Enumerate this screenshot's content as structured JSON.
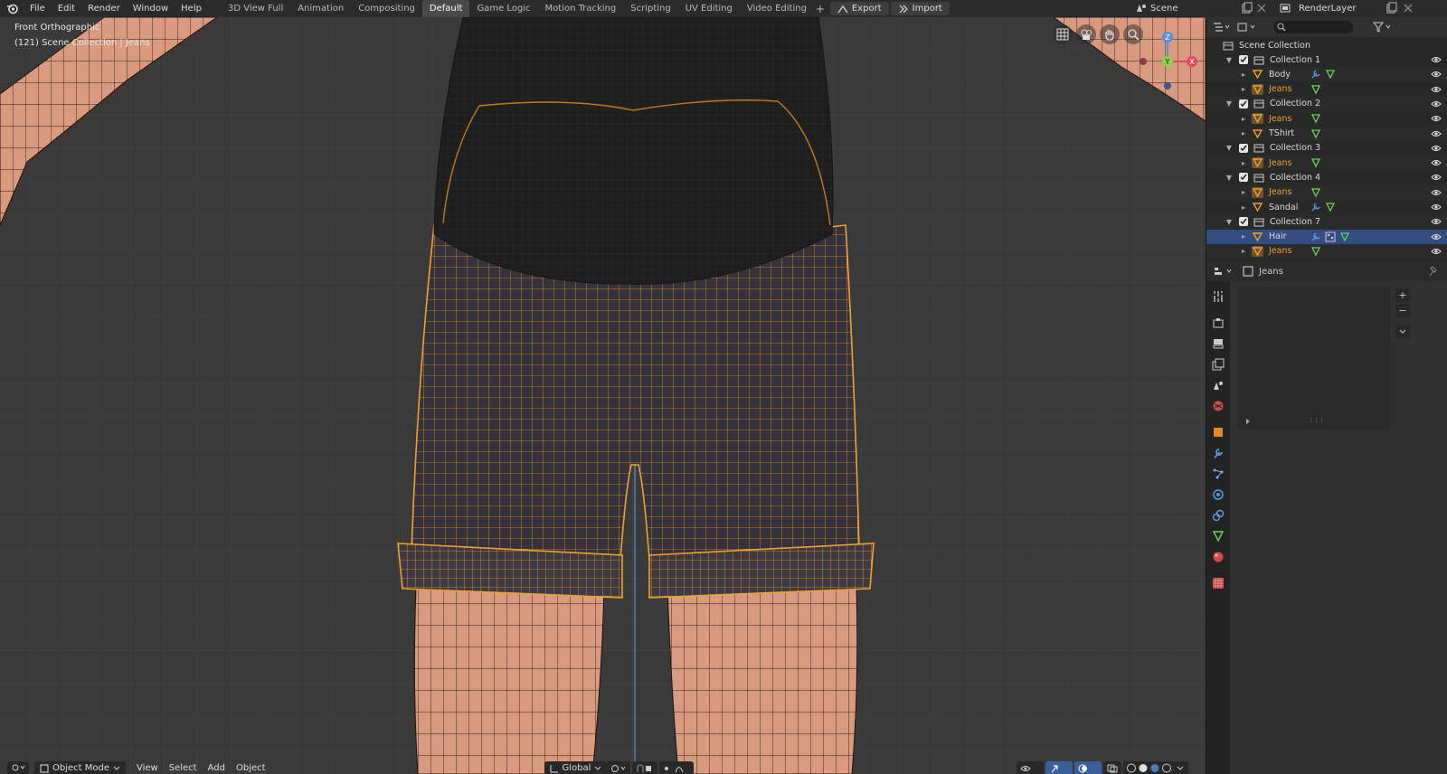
{
  "menu": [
    "File",
    "Edit",
    "Render",
    "Window",
    "Help"
  ],
  "workspace_tabs": [
    {
      "label": "3D View Full",
      "active": false
    },
    {
      "label": "Animation",
      "active": false
    },
    {
      "label": "Compositing",
      "active": false
    },
    {
      "label": "Default",
      "active": true
    },
    {
      "label": "Game Logic",
      "active": false
    },
    {
      "label": "Motion Tracking",
      "active": false
    },
    {
      "label": "Scripting",
      "active": false
    },
    {
      "label": "UV Editing",
      "active": false
    },
    {
      "label": "Video Editing",
      "active": false
    }
  ],
  "toolbar": {
    "add_tab": "+",
    "export_label": "Export",
    "import_label": "Import"
  },
  "scene": {
    "name": "Scene",
    "render_layer": "RenderLayer"
  },
  "viewport": {
    "view_name": "Front Orthographic",
    "context": "(121) Scene Collection | Jeans",
    "gizmo": {
      "x": "X",
      "y": "Y",
      "z": "Z"
    }
  },
  "vp_header": {
    "mode": "Object Mode",
    "menus": [
      "View",
      "Select",
      "Add",
      "Object"
    ],
    "orientation": "Global"
  },
  "outliner": {
    "root": "Scene Collection",
    "rows": [
      {
        "label": "Collection 1",
        "type": "collection",
        "level": 1,
        "icons": []
      },
      {
        "label": "Body",
        "type": "object",
        "level": 2,
        "icons": [
          "wrench-icon",
          "mesh-icon"
        ]
      },
      {
        "label": "Jeans",
        "type": "object-selected",
        "level": 2,
        "icons": [
          "mesh-icon"
        ]
      },
      {
        "label": "Collection 2",
        "type": "collection",
        "level": 1,
        "icons": []
      },
      {
        "label": "Jeans",
        "type": "object-selected",
        "level": 2,
        "icons": [
          "mesh-icon"
        ]
      },
      {
        "label": "TShirt",
        "type": "object",
        "level": 2,
        "icons": [
          "mesh-icon"
        ]
      },
      {
        "label": "Collection 3",
        "type": "collection",
        "level": 1,
        "icons": []
      },
      {
        "label": "Jeans",
        "type": "object-selected",
        "level": 2,
        "icons": [
          "mesh-icon"
        ]
      },
      {
        "label": "Collection 4",
        "type": "collection",
        "level": 1,
        "icons": []
      },
      {
        "label": "Jeans",
        "type": "object-selected",
        "level": 2,
        "icons": [
          "mesh-icon"
        ]
      },
      {
        "label": "Sandal",
        "type": "object",
        "level": 2,
        "icons": [
          "wrench-icon",
          "mesh-icon"
        ]
      },
      {
        "label": "Collection 7",
        "type": "collection",
        "level": 1,
        "icons": []
      },
      {
        "label": "Hair",
        "type": "object-highlight",
        "level": 2,
        "icons": [
          "wrench-icon",
          "particles-icon",
          "mesh-icon"
        ]
      },
      {
        "label": "Jeans",
        "type": "object-selected",
        "level": 2,
        "icons": [
          "mesh-icon"
        ]
      }
    ]
  },
  "properties": {
    "object_name": "Jeans",
    "add": "+",
    "remove": "−",
    "more": "⋮⋮⋮"
  },
  "colors": {
    "selection_orange": "#f0a030",
    "highlight_blue": "#334d80",
    "viewport_bg": "#3a3a3a"
  }
}
